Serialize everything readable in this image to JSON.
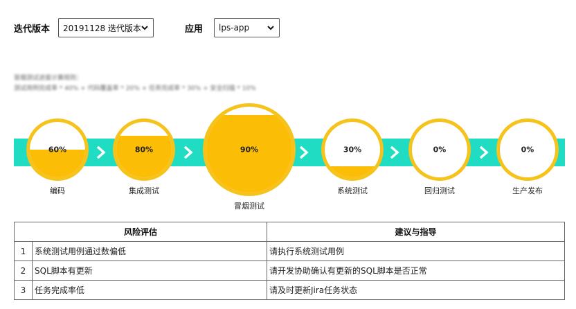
{
  "filters": {
    "iteration_label": "迭代版本",
    "iteration_value": "20191128 迭代版本",
    "app_label": "应用",
    "app_value": "lps-app"
  },
  "note": {
    "line1": "冒烟测试进度计算规则：",
    "line2": "测试用例完成率 * 40% + 代码覆盖率 * 20% + 任务完成率 * 30% + 安全扫描 * 10%"
  },
  "colors": {
    "band": "#1fdcc3",
    "ring": "#f6c21c",
    "fill": "#fbbd05",
    "arrow": "#ffffff"
  },
  "stages": [
    {
      "label": "编码",
      "percent_text": "60%",
      "progress": 0.5
    },
    {
      "label": "集成测试",
      "percent_text": "80%",
      "progress": 0.75
    },
    {
      "label": "冒烟测试",
      "percent_text": "90%",
      "progress": 0.9
    },
    {
      "label": "系统测试",
      "percent_text": "30%",
      "progress": 0.2
    },
    {
      "label": "回归测试",
      "percent_text": "0%",
      "progress": 0
    },
    {
      "label": "生产发布",
      "percent_text": "0%",
      "progress": 0
    }
  ],
  "table": {
    "headers": [
      "风险评估",
      "建议与指导"
    ],
    "rows": [
      {
        "index": "1",
        "risk": "系统测试用例通过数偏低",
        "advice": "请执行系统测试用例"
      },
      {
        "index": "2",
        "risk": "SQL脚本有更新",
        "advice": "请开发协助确认有更新的SQL脚本是否正常"
      },
      {
        "index": "3",
        "risk": "任务完成率低",
        "advice": "请及时更新Jira任务状态"
      }
    ]
  }
}
